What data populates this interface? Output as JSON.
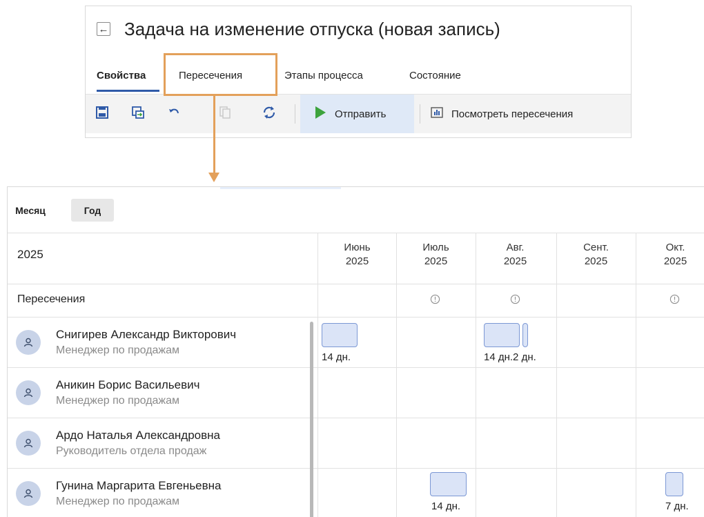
{
  "task_window": {
    "title": "Задача на изменение отпуска (новая запись)",
    "tabs": [
      {
        "label": "Свойства",
        "active": true
      },
      {
        "label": "Пересечения",
        "active": false
      },
      {
        "label": "Этапы процесса",
        "active": false
      },
      {
        "label": "Состояние",
        "active": false
      }
    ],
    "toolbar": {
      "send_label": "Отправить",
      "view_overlaps_label": "Посмотреть пересечения"
    }
  },
  "calendar": {
    "modes": [
      "Месяц",
      "Год"
    ],
    "selected_mode": "Год",
    "year": "2025",
    "months": [
      {
        "name": "Июнь",
        "year": "2025"
      },
      {
        "name": "Июль",
        "year": "2025"
      },
      {
        "name": "Авг.",
        "year": "2025"
      },
      {
        "name": "Сент.",
        "year": "2025"
      },
      {
        "name": "Окт.",
        "year": "2025"
      }
    ],
    "overlaps_label": "Пересечения",
    "overlap_months": [
      "Июль",
      "Авг.",
      "Окт."
    ],
    "employees": [
      {
        "name": "Снигирев Александр Викторович",
        "role": "Менеджер по продажам",
        "vacations": [
          {
            "month": "Июнь",
            "label": "14 дн."
          },
          {
            "month": "Авг.",
            "label": "14 дн.2 дн."
          }
        ]
      },
      {
        "name": "Аникин Борис Васильевич",
        "role": "Менеджер по продажам",
        "vacations": []
      },
      {
        "name": "Ардо Наталья Александровна",
        "role": "Руководитель отдела продаж",
        "vacations": []
      },
      {
        "name": "Гунина Маргарита Евгеньевна",
        "role": "Менеджер по продажам",
        "vacations": [
          {
            "month": "Июль",
            "label": "14 дн."
          },
          {
            "month": "Окт.",
            "label": "7 дн."
          }
        ]
      }
    ]
  },
  "colors": {
    "accent": "#2f5aa8",
    "highlight": "#e3a05a",
    "send_green": "#3da33d",
    "vacation_fill": "#dbe4f7",
    "vacation_border": "#7b97d4"
  }
}
